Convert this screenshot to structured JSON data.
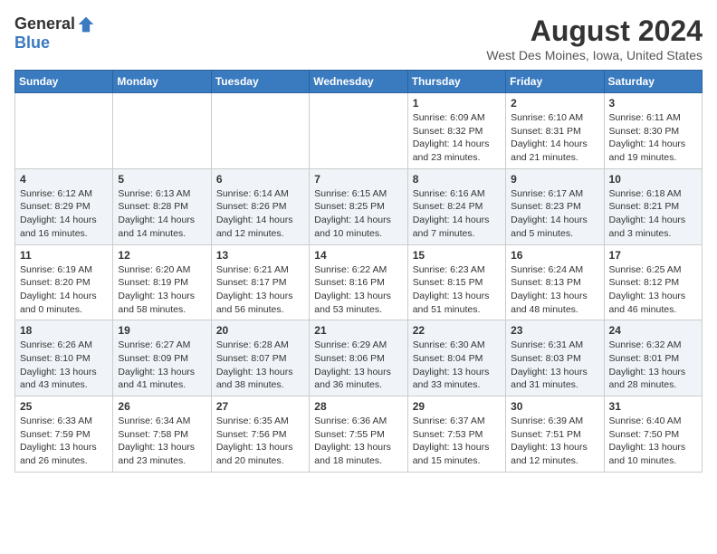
{
  "logo": {
    "general": "General",
    "blue": "Blue"
  },
  "title": "August 2024",
  "subtitle": "West Des Moines, Iowa, United States",
  "days_of_week": [
    "Sunday",
    "Monday",
    "Tuesday",
    "Wednesday",
    "Thursday",
    "Friday",
    "Saturday"
  ],
  "weeks": [
    [
      {
        "day": "",
        "info": ""
      },
      {
        "day": "",
        "info": ""
      },
      {
        "day": "",
        "info": ""
      },
      {
        "day": "",
        "info": ""
      },
      {
        "day": "1",
        "info": "Sunrise: 6:09 AM\nSunset: 8:32 PM\nDaylight: 14 hours and 23 minutes."
      },
      {
        "day": "2",
        "info": "Sunrise: 6:10 AM\nSunset: 8:31 PM\nDaylight: 14 hours and 21 minutes."
      },
      {
        "day": "3",
        "info": "Sunrise: 6:11 AM\nSunset: 8:30 PM\nDaylight: 14 hours and 19 minutes."
      }
    ],
    [
      {
        "day": "4",
        "info": "Sunrise: 6:12 AM\nSunset: 8:29 PM\nDaylight: 14 hours and 16 minutes."
      },
      {
        "day": "5",
        "info": "Sunrise: 6:13 AM\nSunset: 8:28 PM\nDaylight: 14 hours and 14 minutes."
      },
      {
        "day": "6",
        "info": "Sunrise: 6:14 AM\nSunset: 8:26 PM\nDaylight: 14 hours and 12 minutes."
      },
      {
        "day": "7",
        "info": "Sunrise: 6:15 AM\nSunset: 8:25 PM\nDaylight: 14 hours and 10 minutes."
      },
      {
        "day": "8",
        "info": "Sunrise: 6:16 AM\nSunset: 8:24 PM\nDaylight: 14 hours and 7 minutes."
      },
      {
        "day": "9",
        "info": "Sunrise: 6:17 AM\nSunset: 8:23 PM\nDaylight: 14 hours and 5 minutes."
      },
      {
        "day": "10",
        "info": "Sunrise: 6:18 AM\nSunset: 8:21 PM\nDaylight: 14 hours and 3 minutes."
      }
    ],
    [
      {
        "day": "11",
        "info": "Sunrise: 6:19 AM\nSunset: 8:20 PM\nDaylight: 14 hours and 0 minutes."
      },
      {
        "day": "12",
        "info": "Sunrise: 6:20 AM\nSunset: 8:19 PM\nDaylight: 13 hours and 58 minutes."
      },
      {
        "day": "13",
        "info": "Sunrise: 6:21 AM\nSunset: 8:17 PM\nDaylight: 13 hours and 56 minutes."
      },
      {
        "day": "14",
        "info": "Sunrise: 6:22 AM\nSunset: 8:16 PM\nDaylight: 13 hours and 53 minutes."
      },
      {
        "day": "15",
        "info": "Sunrise: 6:23 AM\nSunset: 8:15 PM\nDaylight: 13 hours and 51 minutes."
      },
      {
        "day": "16",
        "info": "Sunrise: 6:24 AM\nSunset: 8:13 PM\nDaylight: 13 hours and 48 minutes."
      },
      {
        "day": "17",
        "info": "Sunrise: 6:25 AM\nSunset: 8:12 PM\nDaylight: 13 hours and 46 minutes."
      }
    ],
    [
      {
        "day": "18",
        "info": "Sunrise: 6:26 AM\nSunset: 8:10 PM\nDaylight: 13 hours and 43 minutes."
      },
      {
        "day": "19",
        "info": "Sunrise: 6:27 AM\nSunset: 8:09 PM\nDaylight: 13 hours and 41 minutes."
      },
      {
        "day": "20",
        "info": "Sunrise: 6:28 AM\nSunset: 8:07 PM\nDaylight: 13 hours and 38 minutes."
      },
      {
        "day": "21",
        "info": "Sunrise: 6:29 AM\nSunset: 8:06 PM\nDaylight: 13 hours and 36 minutes."
      },
      {
        "day": "22",
        "info": "Sunrise: 6:30 AM\nSunset: 8:04 PM\nDaylight: 13 hours and 33 minutes."
      },
      {
        "day": "23",
        "info": "Sunrise: 6:31 AM\nSunset: 8:03 PM\nDaylight: 13 hours and 31 minutes."
      },
      {
        "day": "24",
        "info": "Sunrise: 6:32 AM\nSunset: 8:01 PM\nDaylight: 13 hours and 28 minutes."
      }
    ],
    [
      {
        "day": "25",
        "info": "Sunrise: 6:33 AM\nSunset: 7:59 PM\nDaylight: 13 hours and 26 minutes."
      },
      {
        "day": "26",
        "info": "Sunrise: 6:34 AM\nSunset: 7:58 PM\nDaylight: 13 hours and 23 minutes."
      },
      {
        "day": "27",
        "info": "Sunrise: 6:35 AM\nSunset: 7:56 PM\nDaylight: 13 hours and 20 minutes."
      },
      {
        "day": "28",
        "info": "Sunrise: 6:36 AM\nSunset: 7:55 PM\nDaylight: 13 hours and 18 minutes."
      },
      {
        "day": "29",
        "info": "Sunrise: 6:37 AM\nSunset: 7:53 PM\nDaylight: 13 hours and 15 minutes."
      },
      {
        "day": "30",
        "info": "Sunrise: 6:39 AM\nSunset: 7:51 PM\nDaylight: 13 hours and 12 minutes."
      },
      {
        "day": "31",
        "info": "Sunrise: 6:40 AM\nSunset: 7:50 PM\nDaylight: 13 hours and 10 minutes."
      }
    ]
  ]
}
